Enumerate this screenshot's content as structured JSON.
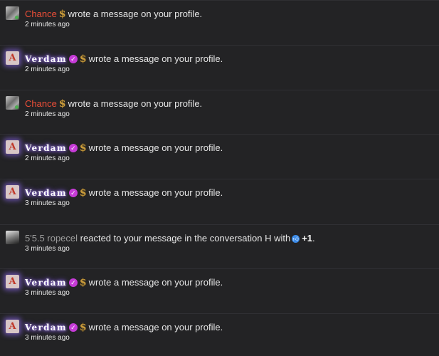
{
  "notifications": [
    {
      "user": "Chance",
      "style": "chance",
      "badge": "",
      "icon": "dollar-icon",
      "action": "wrote a message on your profile.",
      "time": "2 minutes ago"
    },
    {
      "user": "Verdam",
      "style": "verdam",
      "badge": "verified",
      "icon": "dollar-icon",
      "action": "wrote a message on your profile.",
      "time": "2 minutes ago"
    },
    {
      "user": "Chance",
      "style": "chance",
      "badge": "",
      "icon": "dollar-icon",
      "action": "wrote a message on your profile.",
      "time": "2 minutes ago"
    },
    {
      "user": "Verdam",
      "style": "verdam",
      "badge": "verified",
      "icon": "dollar-icon",
      "action": "wrote a message on your profile.",
      "time": "2 minutes ago"
    },
    {
      "user": "Verdam",
      "style": "verdam",
      "badge": "verified",
      "icon": "dollar-icon",
      "action": "wrote a message on your profile.",
      "time": "3 minutes ago"
    },
    {
      "user": "5'5.5 ropecel",
      "style": "ropecel",
      "badge": "",
      "icon": "",
      "action": "reacted to your message in the conversation H with",
      "reaction": "+1",
      "reaction_end": ".",
      "time": "3 minutes ago"
    },
    {
      "user": "Verdam",
      "style": "verdam",
      "badge": "verified",
      "icon": "dollar-icon",
      "action": "wrote a message on your profile.",
      "time": "3 minutes ago"
    },
    {
      "user": "Verdam",
      "style": "verdam",
      "badge": "verified",
      "icon": "dollar-icon",
      "action": "wrote a message on your profile.",
      "time": "3 minutes ago"
    }
  ],
  "colors": {
    "background": "#232325",
    "divider": "#303034",
    "chance_name": "#ef4f38",
    "verdam_glow": "#b28cff",
    "verified_badge": "#c63bd7",
    "dollar_icon": "#c89b3c",
    "reaction_thumb": "#3c8be8"
  }
}
